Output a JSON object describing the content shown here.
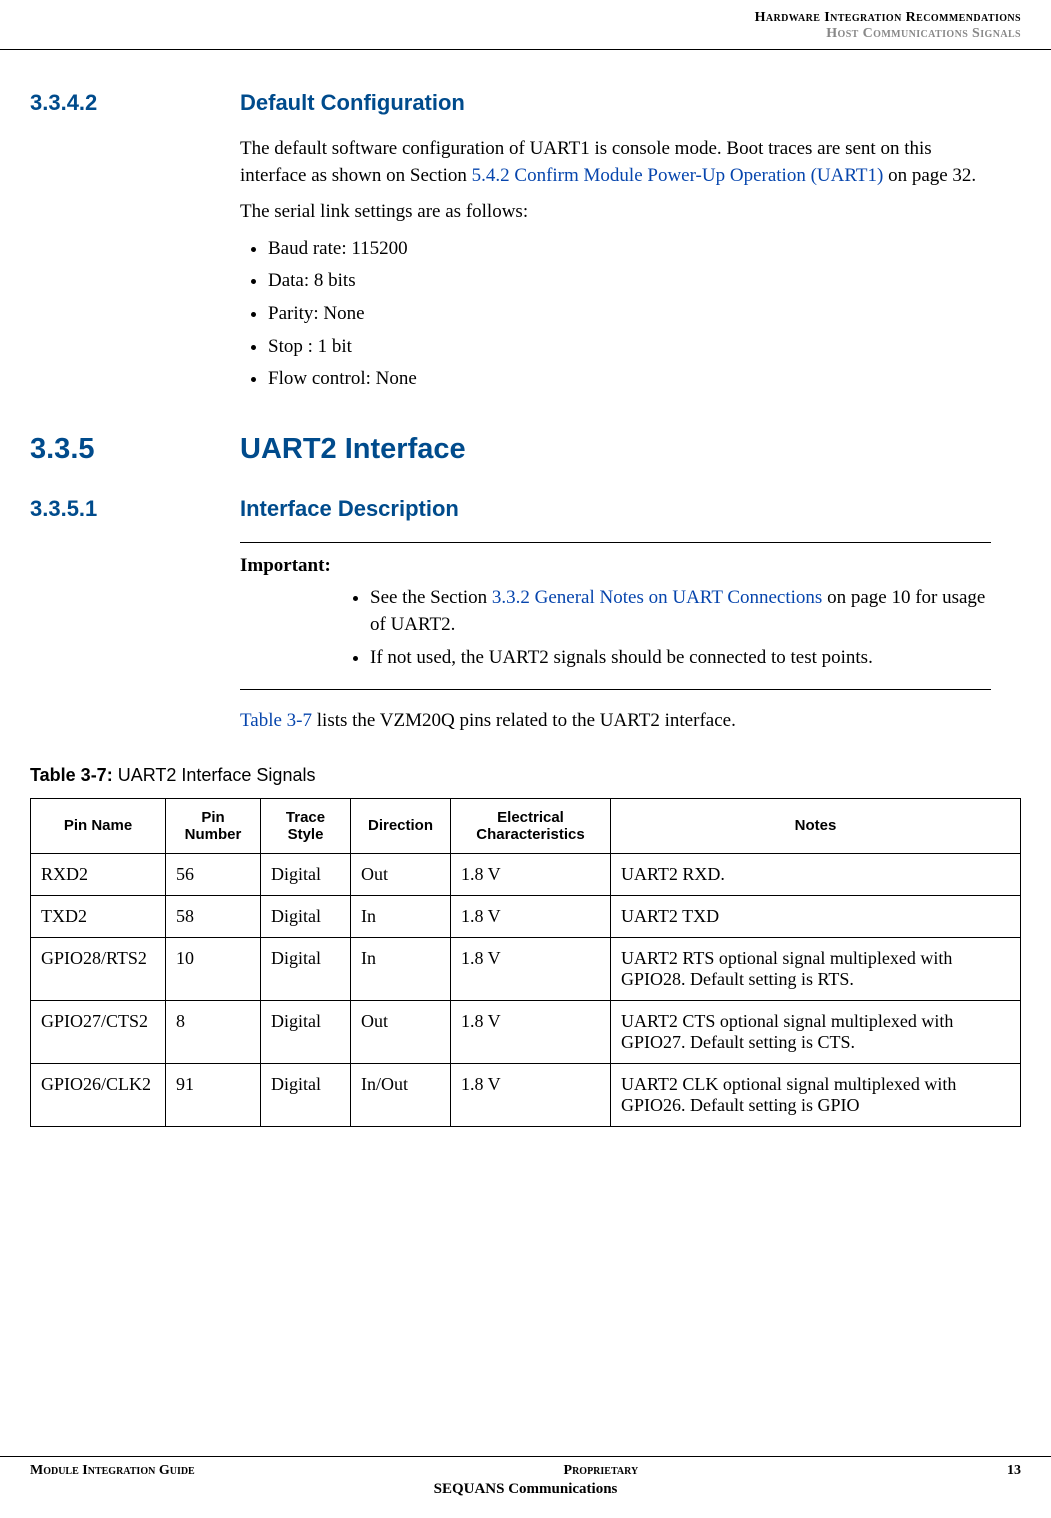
{
  "header": {
    "line1": "Hardware Integration Recommendations",
    "line2": "Host Communications Signals"
  },
  "sections": {
    "s3342": {
      "num": "3.3.4.2",
      "title": "Default Configuration"
    },
    "s335": {
      "num": "3.3.5",
      "title": "UART2 Interface"
    },
    "s3351": {
      "num": "3.3.5.1",
      "title": "Interface Description"
    }
  },
  "para": {
    "default_1a": "The default software configuration of UART1 is console mode. Boot traces are sent on this interface as shown on Section ",
    "default_1_link": "5.4.2 Confirm Module Power-Up Operation (UART1)",
    "default_1b": " on page 32.",
    "default_2": "The serial link settings are as follows:"
  },
  "serial_settings": [
    "Baud rate: 115200",
    "Data: 8 bits",
    "Parity: None",
    "Stop : 1 bit",
    "Flow control: None"
  ],
  "note": {
    "label": "Important:",
    "item1a": "See the Section ",
    "item1_link": "3.3.2 General Notes on UART Connections",
    "item1b": " on page 10 for usage of UART2.",
    "item2": "If not used, the UART2 signals  should be connected to test points."
  },
  "para_table_intro_link": "Table 3-7",
  "para_table_intro_rest": " lists the VZM20Q pins related to the UART2 interface.",
  "table": {
    "caption_num": "Table 3-7: ",
    "caption_title": "UART2 Interface Signals",
    "headers": [
      "Pin Name",
      "Pin Number",
      "Trace Style",
      "Direction",
      "Electrical Characteristics",
      "Notes"
    ],
    "rows": [
      {
        "c": [
          "RXD2",
          "56",
          "Digital",
          "Out",
          "1.8 V",
          "UART2 RXD."
        ]
      },
      {
        "c": [
          "TXD2",
          "58",
          "Digital",
          "In",
          "1.8 V",
          "UART2 TXD"
        ]
      },
      {
        "c": [
          "GPIO28/RTS2",
          "10",
          "Digital",
          "In",
          "1.8 V",
          "UART2 RTS optional signal multiplexed with GPIO28. Default setting is RTS."
        ]
      },
      {
        "c": [
          "GPIO27/CTS2",
          "8",
          "Digital",
          "Out",
          "1.8 V",
          "UART2 CTS optional signal multiplexed with GPIO27. Default setting is CTS."
        ]
      },
      {
        "c": [
          "GPIO26/CLK2",
          "91",
          "Digital",
          "In/Out",
          "1.8 V",
          "UART2 CLK optional signal multiplexed with GPIO26. Default setting is GPIO"
        ]
      }
    ]
  },
  "footer": {
    "left": "Module Integration Guide",
    "center": "Proprietary",
    "right": "13",
    "sub": "SEQUANS Communications"
  }
}
